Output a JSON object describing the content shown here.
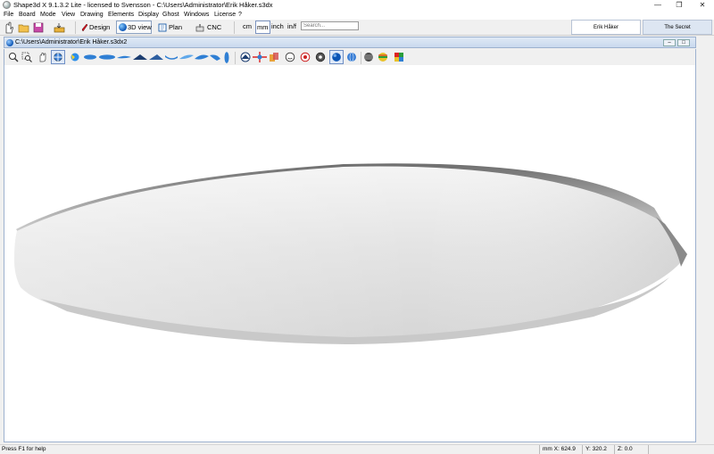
{
  "window": {
    "title": "Shape3d X 9.1.3.2 Lite - licensed to Svensson - C:\\Users\\Administrator\\Erik Håker.s3dx",
    "controls": {
      "minimize": "—",
      "restore": "❐",
      "close": "✕"
    }
  },
  "menu": [
    "File",
    "Board",
    "Mode",
    "View",
    "Drawing",
    "Elements",
    "Display",
    "Ghost",
    "Windows",
    "License",
    "?"
  ],
  "toolbar": {
    "design_label": "Design",
    "view3d_label": "3D view",
    "plan_label": "Plan",
    "cnc_label": "CNC",
    "units": [
      "cm",
      "mm",
      "inch",
      "in/f"
    ],
    "active_unit": "mm",
    "search_placeholder": "Search...",
    "tabs": [
      "Erik Håker",
      "The Secret"
    ]
  },
  "document": {
    "title": "C:\\Users\\Administrator\\Erik Håker.s3dx2"
  },
  "status": {
    "help": "Press F1 for help",
    "mm_x": "mm X: 624.9",
    "y": "Y: 320.2",
    "z": "Z: 0.0"
  },
  "colors": {
    "accent": "#0a54b5",
    "board_light": "#e8e8e8",
    "board_shade": "#9a9a9a"
  }
}
